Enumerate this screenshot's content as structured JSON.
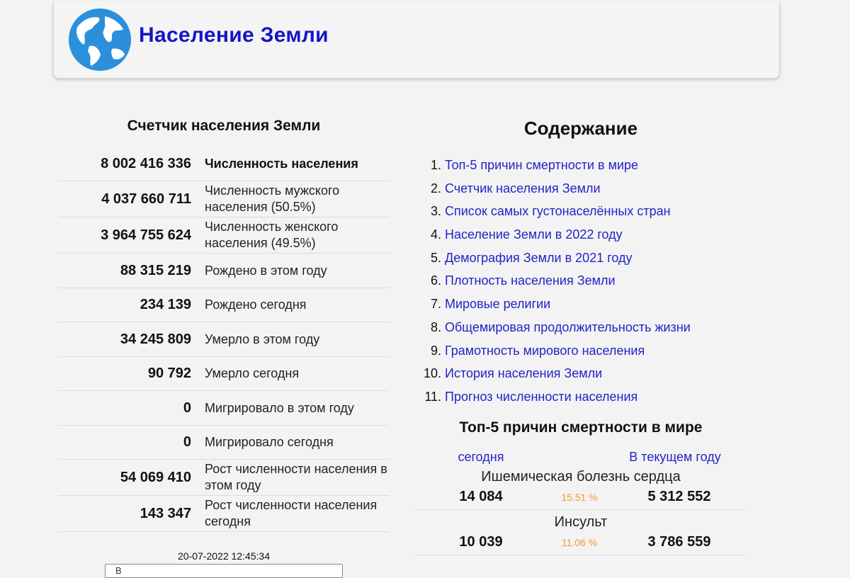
{
  "header": {
    "title": "Население Земли",
    "logo_icon": "globe-icon"
  },
  "counter": {
    "title": "Счетчик населения Земли",
    "rows": [
      {
        "value": "8 002 416 336",
        "label": "Численность населения"
      },
      {
        "value": "4 037 660 711",
        "label": "Численность мужского населения (50.5%)"
      },
      {
        "value": "3 964 755 624",
        "label": "Численность женского населения (49.5%)"
      },
      {
        "value": "88 315 219",
        "label": "Рождено в этом году"
      },
      {
        "value": "234 139",
        "label": "Рождено сегодня"
      },
      {
        "value": "34 245 809",
        "label": "Умерло в этом году"
      },
      {
        "value": "90 792",
        "label": "Умерло сегодня"
      },
      {
        "value": "0",
        "label": "Мигрировало в этом году"
      },
      {
        "value": "0",
        "label": "Мигрировало сегодня"
      },
      {
        "value": "54 069 410",
        "label": "Рост численности населения в этом году"
      },
      {
        "value": "143 347",
        "label": "Рост численности населения сегодня"
      }
    ],
    "timestamp": "20-07-2022 12:45:34",
    "select_value": "В"
  },
  "toc": {
    "title": "Содержание",
    "items": [
      {
        "num": "1.",
        "label": "Топ-5 причин смертности в мире"
      },
      {
        "num": "2.",
        "label": "Счетчик населения Земли"
      },
      {
        "num": "3.",
        "label": "Список самых густонаселённых стран"
      },
      {
        "num": "4.",
        "label": "Население Земли в 2022 году"
      },
      {
        "num": "5.",
        "label": "Демография Земли в 2021 году"
      },
      {
        "num": "6.",
        "label": "Плотность населения Земли"
      },
      {
        "num": "7.",
        "label": "Мировые религии"
      },
      {
        "num": "8.",
        "label": "Общемировая продолжительность жизни"
      },
      {
        "num": "9.",
        "label": "Грамотность мирового населения"
      },
      {
        "num": "10.",
        "label": "История населения Земли"
      },
      {
        "num": "11.",
        "label": "Прогноз численности населения"
      }
    ]
  },
  "causes": {
    "title": "Топ-5 причин смертности в мире",
    "today_label": "сегодня",
    "year_label": "В текущем году",
    "items": [
      {
        "name": "Ишемическая болезнь сердца",
        "today": "14 084",
        "percent": "15.51 %",
        "year": "5 312 552"
      },
      {
        "name": "Инсульт",
        "today": "10 039",
        "percent": "11.06 %",
        "year": "3 786 559"
      }
    ]
  },
  "colors": {
    "link": "#2323c8",
    "title": "#1515c9",
    "percent": "#f29a2e",
    "background": "#f3f3f3"
  }
}
